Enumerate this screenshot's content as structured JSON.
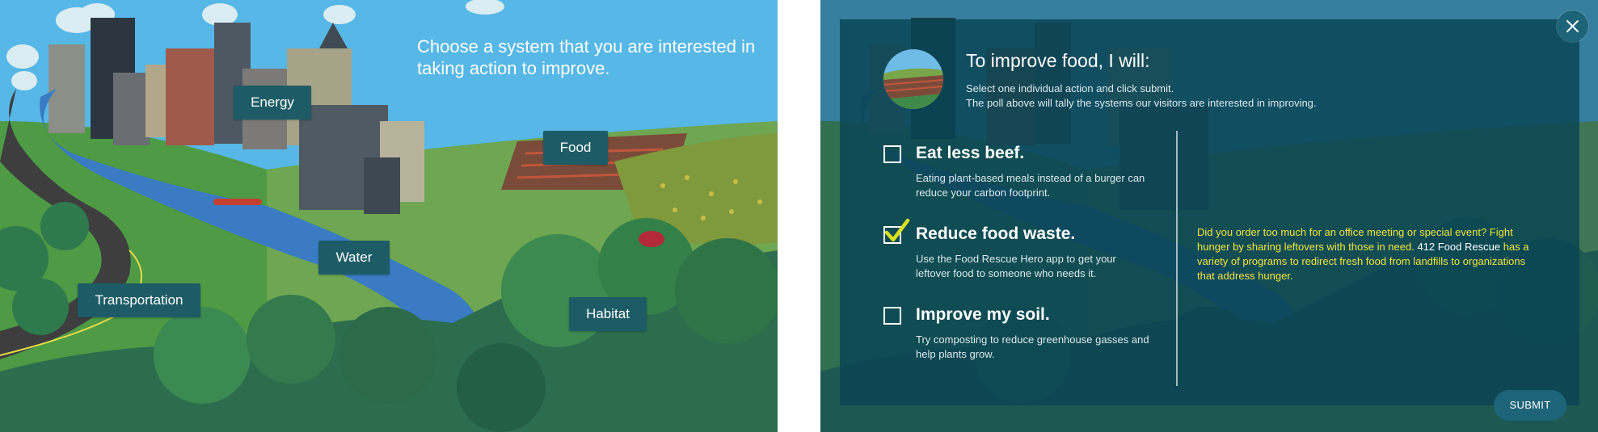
{
  "left_screen": {
    "prompt": "Choose a system that you are interested in taking action to improve.",
    "systems": {
      "energy": "Energy",
      "food": "Food",
      "water": "Water",
      "transportation": "Transportation",
      "habitat": "Habitat"
    }
  },
  "right_screen": {
    "title": "To improve food, I will:",
    "instruction_line1": "Select one individual action and click submit.",
    "instruction_line2": "The poll above will tally the systems our visitors are interested in improving.",
    "options": [
      {
        "title": "Eat less beef.",
        "description": "Eating plant-based meals instead of a burger can reduce your carbon footprint.",
        "checked": false
      },
      {
        "title": "Reduce food waste.",
        "description": "Use the Food Rescue Hero app to get your leftover food to someone who needs it.",
        "checked": true
      },
      {
        "title": "Improve my soil.",
        "description": "Try composting to reduce greenhouse gasses and help plants grow.",
        "checked": false
      }
    ],
    "info": {
      "text_before": "Did you order too much for an office meeting or special event? Fight hunger by sharing leftovers with those in need. ",
      "highlight": "412 Food Rescue",
      "text_after": " has a variety of programs to redirect fresh food from landfills to organizations that address hunger."
    },
    "submit_label": "SUBMIT"
  },
  "colors": {
    "sky": "#57b7e6",
    "button_teal": "#1d5c66",
    "modal_bg": "#084454",
    "info_text": "#f2e63a",
    "check": "#d9e020"
  },
  "icons": [
    "close-icon",
    "checkbox-icon",
    "checkmark-icon"
  ]
}
